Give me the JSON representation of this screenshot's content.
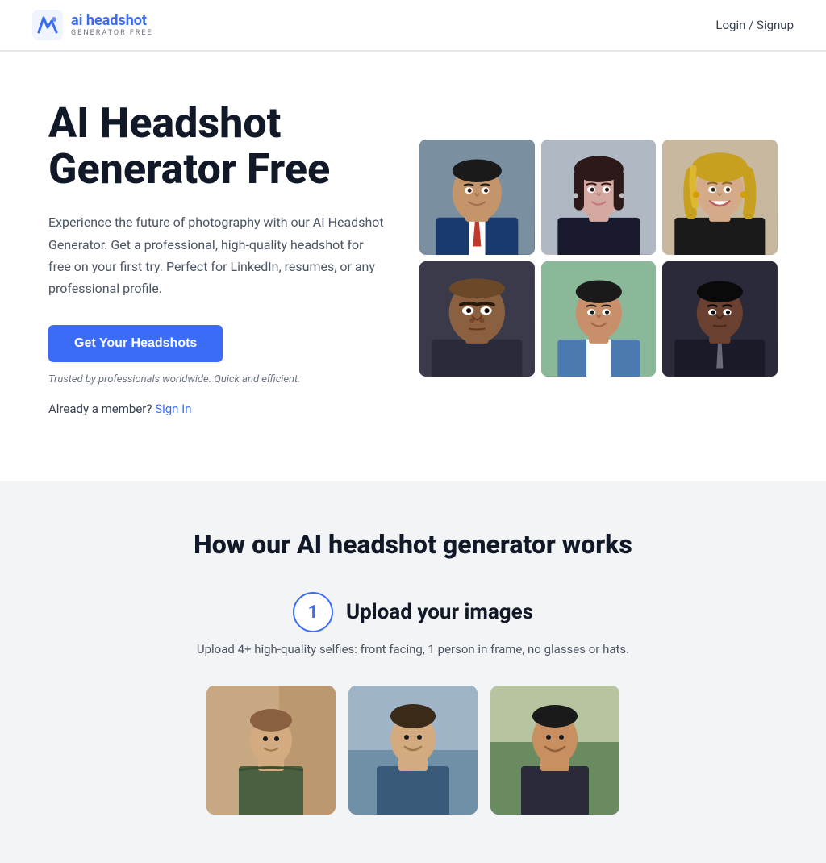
{
  "header": {
    "logo_title_1": "ai",
    "logo_title_2": " headshot",
    "logo_subtitle": "GENERATOR FREE",
    "nav_login_signup": "Login / Signup"
  },
  "hero": {
    "title_line1": "AI Headshot",
    "title_line2": "Generator Free",
    "description": "Experience the future of photography with our AI Headshot Generator. Get a professional, high-quality headshot for free on your first try. Perfect for LinkedIn, resumes, or any professional profile.",
    "cta_button": "Get Your Headshots",
    "trust_text": "Trusted by professionals worldwide. Quick and efficient.",
    "member_text": "Already a member?",
    "sign_in_text": "Sign In"
  },
  "how_it_works": {
    "section_title": "How our AI headshot generator works",
    "step1": {
      "number": "1",
      "title": "Upload your images",
      "description": "Upload 4+ high-quality selfies: front facing, 1 person in frame, no glasses or hats."
    }
  },
  "photos": {
    "grid": [
      {
        "alt": "Professional male headshot 1",
        "style_class": "photo-1"
      },
      {
        "alt": "Professional female headshot 1",
        "style_class": "photo-2"
      },
      {
        "alt": "Professional female headshot 2",
        "style_class": "photo-3"
      },
      {
        "alt": "Professional male headshot 2",
        "style_class": "photo-4"
      },
      {
        "alt": "Professional male headshot 3",
        "style_class": "photo-5"
      },
      {
        "alt": "Professional male headshot 4",
        "style_class": "photo-6"
      }
    ]
  }
}
